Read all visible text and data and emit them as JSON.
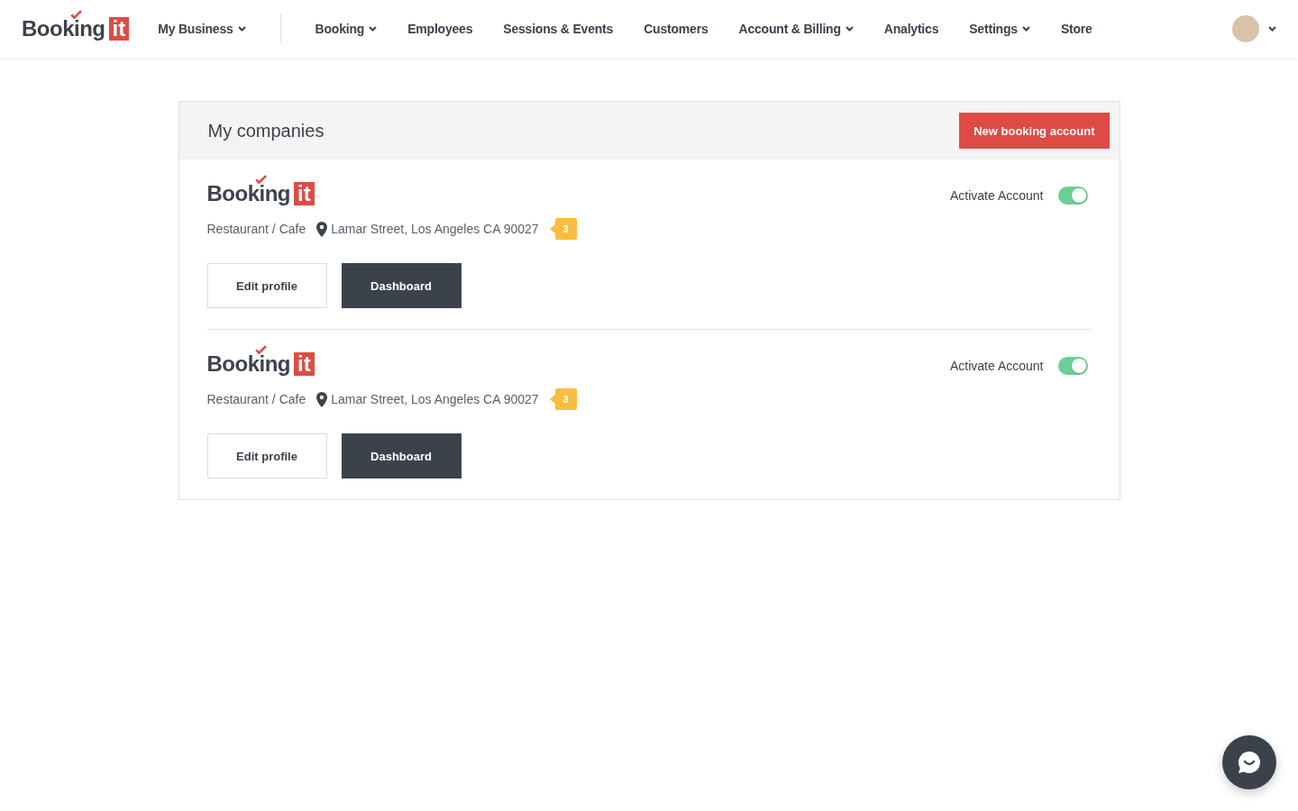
{
  "header": {
    "logo": {
      "word": "Booking",
      "tag": "it"
    },
    "business_menu": {
      "label": "My Business",
      "dropdown": true
    },
    "nav": [
      {
        "label": "Booking",
        "dropdown": true
      },
      {
        "label": "Employees",
        "dropdown": false
      },
      {
        "label": "Sessions & Events",
        "dropdown": false
      },
      {
        "label": "Customers",
        "dropdown": false
      },
      {
        "label": "Account & Billing",
        "dropdown": true
      },
      {
        "label": "Analytics",
        "dropdown": false
      },
      {
        "label": "Settings",
        "dropdown": true
      },
      {
        "label": "Store",
        "dropdown": false
      }
    ]
  },
  "panel": {
    "title": "My companies",
    "new_button": "New booking account",
    "companies": [
      {
        "logo": {
          "word": "Booking",
          "tag": "it"
        },
        "category": "Restaurant / Cafe",
        "address": "Lamar Street, Los Angeles CA 90027",
        "count": "3",
        "activate_label": "Activate Account",
        "active": true,
        "edit_button": "Edit profile",
        "dashboard_button": "Dashboard"
      },
      {
        "logo": {
          "word": "Booking",
          "tag": "it"
        },
        "category": "Restaurant / Cafe",
        "address": "Lamar Street, Los Angeles CA 90027",
        "count": "3",
        "activate_label": "Activate Account",
        "active": true,
        "edit_button": "Edit profile",
        "dashboard_button": "Dashboard"
      }
    ]
  }
}
